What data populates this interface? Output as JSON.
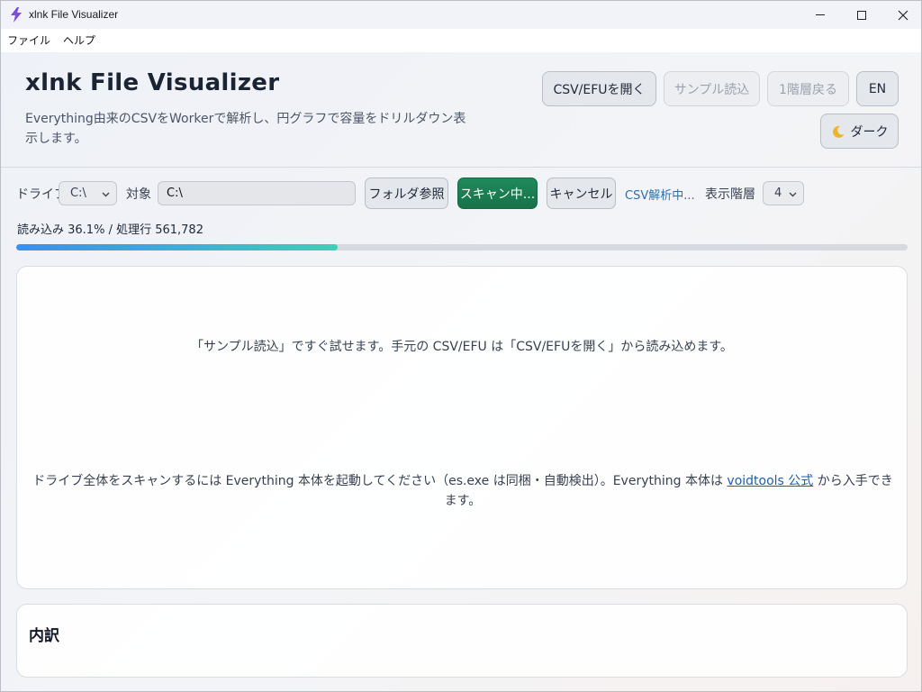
{
  "window": {
    "title": "xlnk File Visualizer",
    "minimize_icon": "minimize-icon",
    "maximize_icon": "maximize-icon",
    "close_icon": "close-icon"
  },
  "menu": {
    "items": [
      "ファイル",
      "ヘルプ"
    ]
  },
  "header": {
    "title": "xlnk File Visualizer",
    "subtitle": "Everything由来のCSVをWorkerで解析し、円グラフで容量をドリルダウン表示します。",
    "buttons": {
      "open": "CSV/EFUを開く",
      "sample": "サンプル読込",
      "up": "1階層戻る",
      "lang": "EN",
      "theme": "ダーク"
    }
  },
  "toolbar": {
    "drive_label": "ドライブ",
    "drive_value": "C:\\",
    "target_label": "対象",
    "target_value": "C:\\",
    "browse": "フォルダ参照",
    "scan": "スキャン中...",
    "cancel": "キャンセル",
    "status": "CSV解析中...",
    "depth_label": "表示階層",
    "depth_value": "4"
  },
  "progress": {
    "text": "読み込み 36.1% / 処理行 561,782",
    "percent": 36.1
  },
  "main": {
    "hint_sample": "「サンプル読込」ですぐ試せます。手元の CSV/EFU は「CSV/EFUを開く」から読み込めます。",
    "hint_everything_before": "ドライブ全体をスキャンするには Everything 本体を起動してください（es.exe は同梱・自動検出）。Everything 本体は ",
    "hint_link": "voidtools 公式",
    "hint_everything_after": " から入手できます。"
  },
  "breakdown": {
    "title": "内訳"
  },
  "colors": {
    "accent_green": "#1f8a5b",
    "progress_start": "#3b8ff0",
    "progress_end": "#3fcfb6",
    "link": "#1d5fa7"
  }
}
